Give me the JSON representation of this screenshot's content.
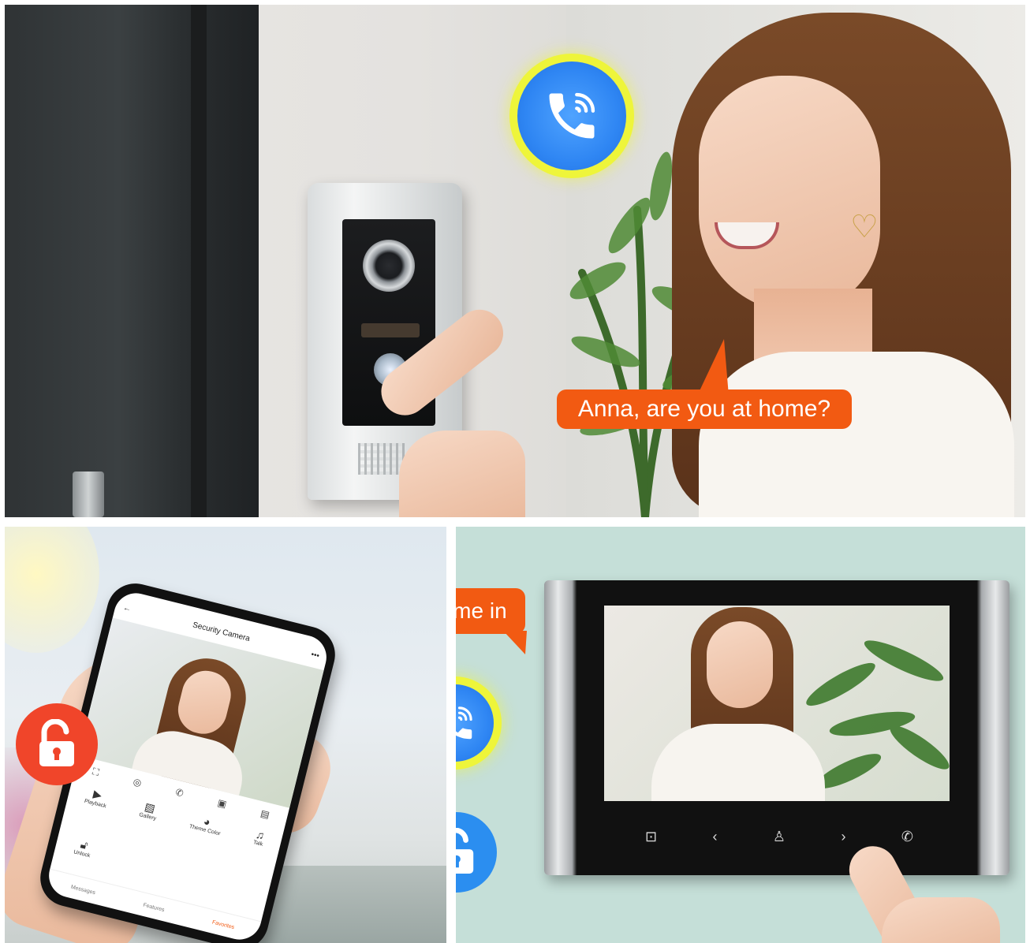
{
  "top_panel": {
    "speech_bubble": "Anna, are you at home?",
    "call_icon": "phone-ringing-icon"
  },
  "bottom_left_panel": {
    "phone_app": {
      "title": "Security Camera",
      "features": [
        "Playback",
        "Gallery",
        "Theme Color",
        "Talk"
      ],
      "unlock_label": "Unlock",
      "tabs": [
        "Messages",
        "Features",
        "Favorites"
      ]
    },
    "unlock_icon": "open-padlock-icon",
    "unlock_icon_color": "#f0452a"
  },
  "bottom_right_panel": {
    "speech_bubble": "Yes, come in",
    "call_icon": "phone-ringing-icon",
    "unlock_icon": "open-padlock-icon",
    "unlock_icon_color": "#2b8ef0",
    "monitor_buttons": [
      "unlock-icon",
      "chevron-left-icon",
      "person-icon",
      "chevron-right-icon",
      "phone-icon"
    ]
  },
  "colors": {
    "bubble": "#f25a12",
    "call_blue": "#2f86f3",
    "call_ring": "#eef53a"
  }
}
